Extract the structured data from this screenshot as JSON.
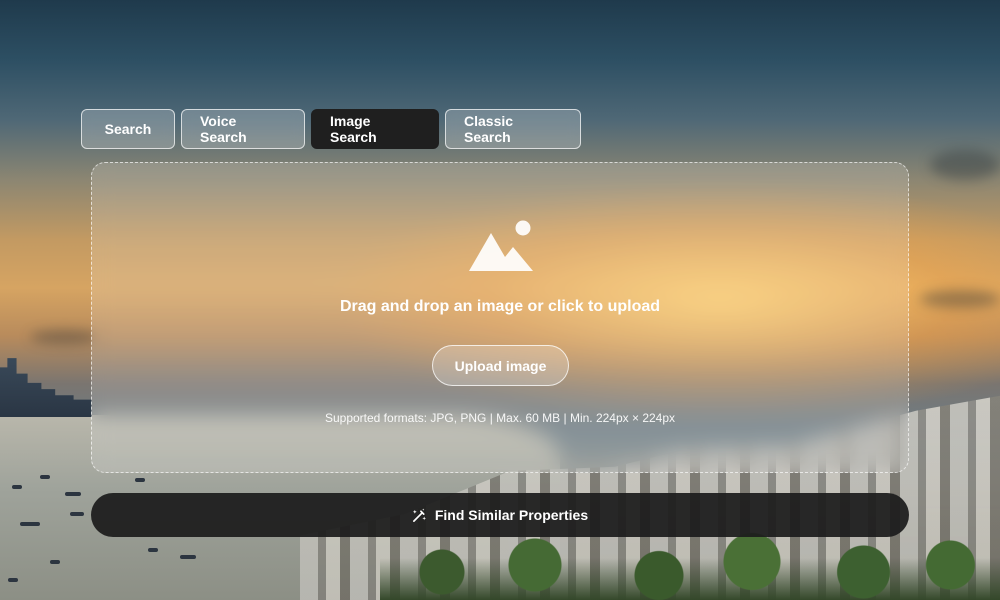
{
  "tabs": {
    "search_label": "Search",
    "voice_label": "Voice Search",
    "image_label": "Image Search",
    "classic_label": "Classic Search",
    "active": "Image Search"
  },
  "upload": {
    "icon": "image-icon",
    "drop_text": "Drag and drop an image or click to upload",
    "button_label": "Upload image",
    "formats_text": "Supported formats: JPG, PNG | Max. 60 MB | Min. 224px × 224px"
  },
  "actions": {
    "find_label": "Find Similar Properties",
    "find_icon": "magic-wand-icon"
  },
  "colors": {
    "active_tab_bg": "#1f1f1f",
    "find_button_bg": "#1c1c1c",
    "text": "#ffffff"
  }
}
